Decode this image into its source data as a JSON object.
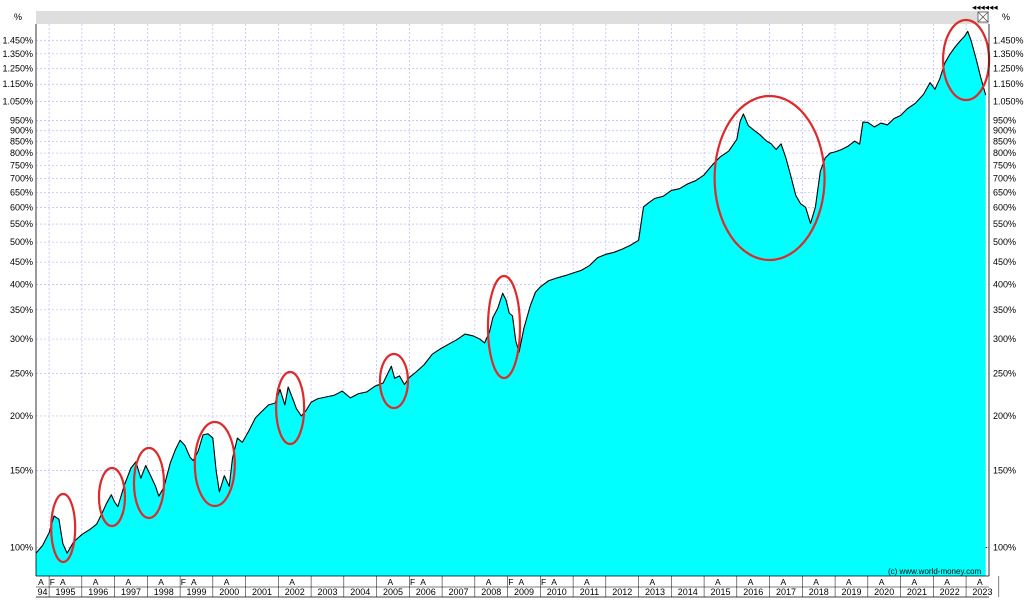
{
  "chart_data": {
    "type": "area",
    "scale": "log",
    "axis_unit_left": "%",
    "axis_unit_right": "%",
    "ylim": [
      86,
      1580
    ],
    "xlim": [
      1994.6,
      2023.7
    ],
    "y_ticks": [
      100,
      150,
      200,
      250,
      300,
      350,
      400,
      450,
      500,
      550,
      600,
      650,
      700,
      750,
      800,
      850,
      900,
      950,
      1050,
      1150,
      1250,
      1350,
      1450
    ],
    "y_tick_labels": [
      "100%",
      "150%",
      "200%",
      "250%",
      "300%",
      "350%",
      "400%",
      "450%",
      "500%",
      "550%",
      "600%",
      "650%",
      "700%",
      "750%",
      "800%",
      "850%",
      "900%",
      "950%",
      "1.050%",
      "1.150%",
      "1.250%",
      "1.350%",
      "1.450%"
    ],
    "year_labels": [
      "94",
      "1995",
      "1996",
      "1997",
      "1998",
      "1999",
      "2000",
      "2001",
      "2002",
      "2003",
      "2004",
      "2005",
      "2006",
      "2007",
      "2008",
      "2009",
      "2010",
      "2011",
      "2012",
      "2013",
      "2014",
      "2015",
      "2016",
      "2017",
      "2018",
      "2019",
      "2020",
      "2021",
      "2022",
      "2023"
    ],
    "month_markers": [
      {
        "t": 1994.75,
        "label": "A"
      },
      {
        "t": 1995.1,
        "label": "F"
      },
      {
        "t": 1995.42,
        "label": "A"
      },
      {
        "t": 1996.42,
        "label": "A"
      },
      {
        "t": 1997.42,
        "label": "A"
      },
      {
        "t": 1998.42,
        "label": "A"
      },
      {
        "t": 1999.1,
        "label": "F"
      },
      {
        "t": 1999.42,
        "label": "A"
      },
      {
        "t": 2000.42,
        "label": "A"
      },
      {
        "t": 2002.42,
        "label": "A"
      },
      {
        "t": 2005.42,
        "label": "A"
      },
      {
        "t": 2006.1,
        "label": "F"
      },
      {
        "t": 2006.42,
        "label": "A"
      },
      {
        "t": 2008.42,
        "label": "A"
      },
      {
        "t": 2009.1,
        "label": "F"
      },
      {
        "t": 2009.42,
        "label": "A"
      },
      {
        "t": 2010.1,
        "label": "F"
      },
      {
        "t": 2010.42,
        "label": "A"
      },
      {
        "t": 2011.42,
        "label": "A"
      },
      {
        "t": 2013.42,
        "label": "A"
      },
      {
        "t": 2015.42,
        "label": "A"
      },
      {
        "t": 2016.42,
        "label": "A"
      },
      {
        "t": 2017.42,
        "label": "A"
      },
      {
        "t": 2018.42,
        "label": "A"
      },
      {
        "t": 2019.42,
        "label": "A"
      },
      {
        "t": 2020.42,
        "label": "A"
      },
      {
        "t": 2021.42,
        "label": "A"
      },
      {
        "t": 2022.42,
        "label": "A"
      },
      {
        "t": 2023.42,
        "label": "A"
      }
    ],
    "series": [
      {
        "points": [
          [
            1994.6,
            97
          ],
          [
            1994.8,
            101
          ],
          [
            1995.0,
            108
          ],
          [
            1995.15,
            118
          ],
          [
            1995.3,
            116
          ],
          [
            1995.42,
            102
          ],
          [
            1995.55,
            97
          ],
          [
            1995.75,
            103
          ],
          [
            1996.0,
            107
          ],
          [
            1996.25,
            110
          ],
          [
            1996.45,
            113
          ],
          [
            1996.6,
            119
          ],
          [
            1996.75,
            126
          ],
          [
            1996.9,
            132
          ],
          [
            1997.0,
            127
          ],
          [
            1997.1,
            124
          ],
          [
            1997.3,
            139
          ],
          [
            1997.5,
            152
          ],
          [
            1997.65,
            157
          ],
          [
            1997.8,
            144
          ],
          [
            1997.95,
            154
          ],
          [
            1998.1,
            146
          ],
          [
            1998.25,
            138
          ],
          [
            1998.35,
            131
          ],
          [
            1998.5,
            137
          ],
          [
            1998.7,
            156
          ],
          [
            1998.85,
            167
          ],
          [
            1999.0,
            176
          ],
          [
            1999.15,
            171
          ],
          [
            1999.3,
            161
          ],
          [
            1999.4,
            158
          ],
          [
            1999.55,
            166
          ],
          [
            1999.7,
            181
          ],
          [
            1999.85,
            182
          ],
          [
            2000.0,
            178
          ],
          [
            2000.1,
            150
          ],
          [
            2000.2,
            134
          ],
          [
            2000.35,
            146
          ],
          [
            2000.5,
            138
          ],
          [
            2000.6,
            160
          ],
          [
            2000.75,
            178
          ],
          [
            2000.9,
            174
          ],
          [
            2001.1,
            185
          ],
          [
            2001.3,
            198
          ],
          [
            2001.5,
            205
          ],
          [
            2001.7,
            212
          ],
          [
            2001.9,
            214
          ],
          [
            2002.05,
            230
          ],
          [
            2002.2,
            212
          ],
          [
            2002.3,
            233
          ],
          [
            2002.45,
            218
          ],
          [
            2002.55,
            208
          ],
          [
            2002.7,
            200
          ],
          [
            2002.85,
            206
          ],
          [
            2003.0,
            215
          ],
          [
            2003.2,
            219
          ],
          [
            2003.45,
            221
          ],
          [
            2003.7,
            223
          ],
          [
            2003.95,
            228
          ],
          [
            2004.2,
            220
          ],
          [
            2004.45,
            225
          ],
          [
            2004.7,
            227
          ],
          [
            2004.95,
            234
          ],
          [
            2005.2,
            238
          ],
          [
            2005.35,
            251
          ],
          [
            2005.45,
            260
          ],
          [
            2005.55,
            244
          ],
          [
            2005.7,
            247
          ],
          [
            2005.85,
            236
          ],
          [
            2006.0,
            245
          ],
          [
            2006.2,
            252
          ],
          [
            2006.45,
            262
          ],
          [
            2006.7,
            277
          ],
          [
            2006.95,
            285
          ],
          [
            2007.2,
            292
          ],
          [
            2007.45,
            299
          ],
          [
            2007.7,
            308
          ],
          [
            2007.95,
            305
          ],
          [
            2008.15,
            300
          ],
          [
            2008.3,
            294
          ],
          [
            2008.45,
            312
          ],
          [
            2008.55,
            336
          ],
          [
            2008.7,
            353
          ],
          [
            2008.85,
            382
          ],
          [
            2008.95,
            369
          ],
          [
            2009.05,
            344
          ],
          [
            2009.15,
            339
          ],
          [
            2009.25,
            297
          ],
          [
            2009.35,
            280
          ],
          [
            2009.5,
            318
          ],
          [
            2009.7,
            359
          ],
          [
            2009.85,
            384
          ],
          [
            2010.0,
            395
          ],
          [
            2010.25,
            408
          ],
          [
            2010.5,
            414
          ],
          [
            2010.75,
            419
          ],
          [
            2011.0,
            425
          ],
          [
            2011.25,
            431
          ],
          [
            2011.5,
            442
          ],
          [
            2011.75,
            461
          ],
          [
            2012.0,
            469
          ],
          [
            2012.25,
            474
          ],
          [
            2012.5,
            482
          ],
          [
            2012.75,
            492
          ],
          [
            2013.0,
            505
          ],
          [
            2013.15,
            602
          ],
          [
            2013.3,
            615
          ],
          [
            2013.5,
            630
          ],
          [
            2013.75,
            637
          ],
          [
            2014.0,
            657
          ],
          [
            2014.25,
            663
          ],
          [
            2014.5,
            680
          ],
          [
            2014.75,
            692
          ],
          [
            2015.0,
            713
          ],
          [
            2015.15,
            736
          ],
          [
            2015.3,
            758
          ],
          [
            2015.5,
            785
          ],
          [
            2015.75,
            808
          ],
          [
            2016.0,
            860
          ],
          [
            2016.1,
            945
          ],
          [
            2016.2,
            983
          ],
          [
            2016.35,
            925
          ],
          [
            2016.5,
            905
          ],
          [
            2016.7,
            882
          ],
          [
            2016.9,
            853
          ],
          [
            2017.05,
            840
          ],
          [
            2017.2,
            815
          ],
          [
            2017.35,
            840
          ],
          [
            2017.5,
            779
          ],
          [
            2017.65,
            708
          ],
          [
            2017.8,
            640
          ],
          [
            2017.95,
            612
          ],
          [
            2018.1,
            601
          ],
          [
            2018.25,
            552
          ],
          [
            2018.4,
            602
          ],
          [
            2018.55,
            727
          ],
          [
            2018.7,
            780
          ],
          [
            2018.85,
            800
          ],
          [
            2019.0,
            805
          ],
          [
            2019.2,
            815
          ],
          [
            2019.4,
            830
          ],
          [
            2019.6,
            852
          ],
          [
            2019.75,
            838
          ],
          [
            2019.85,
            942
          ],
          [
            2020.0,
            940
          ],
          [
            2020.2,
            918
          ],
          [
            2020.4,
            937
          ],
          [
            2020.6,
            928
          ],
          [
            2020.8,
            960
          ],
          [
            2021.0,
            975
          ],
          [
            2021.2,
            1010
          ],
          [
            2021.45,
            1040
          ],
          [
            2021.7,
            1090
          ],
          [
            2021.9,
            1160
          ],
          [
            2022.05,
            1120
          ],
          [
            2022.2,
            1185
          ],
          [
            2022.35,
            1285
          ],
          [
            2022.5,
            1345
          ],
          [
            2022.65,
            1395
          ],
          [
            2022.8,
            1440
          ],
          [
            2022.95,
            1480
          ],
          [
            2023.05,
            1520
          ],
          [
            2023.15,
            1450
          ],
          [
            2023.3,
            1320
          ],
          [
            2023.45,
            1190
          ],
          [
            2023.6,
            1085
          ]
        ]
      }
    ],
    "annotations": "red ellipses highlight drawdown periods",
    "watermark": "(c) www.world-money.com"
  },
  "top_right_icons": "navigation-arrows",
  "colors": {
    "fill": "#00ffff",
    "line": "#000000",
    "grid": "#b8b8ff",
    "circle": "#dd2a2a",
    "topbar": "#dedede"
  }
}
